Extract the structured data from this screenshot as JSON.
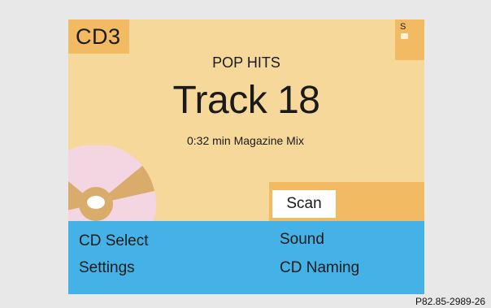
{
  "source": {
    "label": "CD3"
  },
  "corner_tab": {
    "label": "S",
    "icon": "note-icon"
  },
  "now_playing": {
    "category": "POP HITS",
    "track": "Track 18",
    "info": "0:32 min Magazine Mix"
  },
  "scan_button": {
    "label": "Scan"
  },
  "menu": {
    "cd_select": "CD Select",
    "settings": "Settings",
    "sound": "Sound",
    "cd_naming": "CD Naming"
  },
  "figure_code": "P82.85-2989-26",
  "colors": {
    "screen_bg": "#f5d89a",
    "accent_orange": "#f2bb63",
    "menu_blue": "#44b2e6",
    "disc_pink": "#f4d6e3",
    "disc_tan": "#d9ac6b"
  }
}
